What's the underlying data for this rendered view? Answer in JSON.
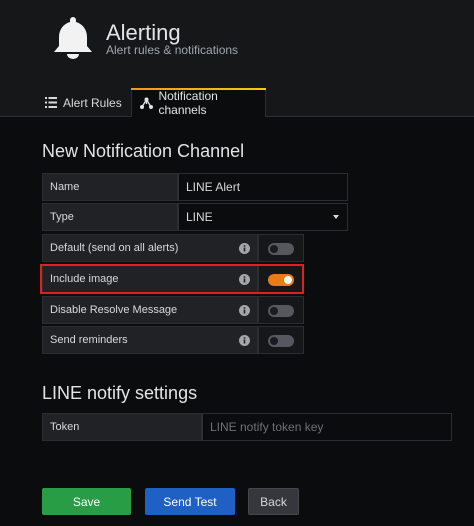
{
  "header": {
    "title": "Alerting",
    "subtitle": "Alert rules & notifications",
    "tabs": [
      {
        "label": "Alert Rules",
        "icon": "list-icon",
        "active": false
      },
      {
        "label": "Notification channels",
        "icon": "share-icon",
        "active": true
      }
    ]
  },
  "form": {
    "heading": "New Notification Channel",
    "name": {
      "label": "Name",
      "value": "LINE Alert"
    },
    "type": {
      "label": "Type",
      "value": "LINE"
    },
    "switches": [
      {
        "label": "Default (send on all alerts)",
        "on": false
      },
      {
        "label": "Include image",
        "on": true
      },
      {
        "label": "Disable Resolve Message",
        "on": false
      },
      {
        "label": "Send reminders",
        "on": false
      }
    ]
  },
  "settings": {
    "heading": "LINE notify settings",
    "token": {
      "label": "Token",
      "placeholder": "LINE notify token key",
      "value": ""
    }
  },
  "buttons": {
    "save": "Save",
    "test": "Send Test",
    "back": "Back"
  },
  "colors": {
    "accent_orange": "#eb7b18",
    "save_green": "#299c46",
    "test_blue": "#1f60c4",
    "highlight_red": "#e02020"
  }
}
